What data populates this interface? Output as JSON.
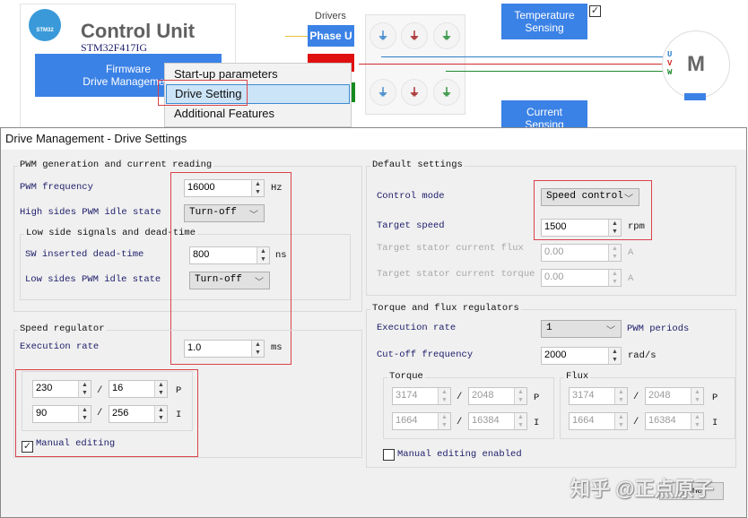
{
  "background": {
    "control_unit": {
      "title": "Control Unit",
      "mcu": "STM32F417IG",
      "logo_text": "STM32",
      "firmware_line1": "Firmware",
      "firmware_line2": "Drive Management"
    },
    "drivers_label": "Drivers",
    "phase_u": "Phase U",
    "temperature_sensing": "Temperature Sensing",
    "current_sensing": "Current Sensing",
    "motor": {
      "label": "M",
      "u": "U",
      "v": "V",
      "w": "W"
    },
    "context_menu": {
      "items": [
        {
          "label": "Start-up parameters",
          "selected": false
        },
        {
          "label": "Drive Setting",
          "selected": true
        },
        {
          "label": "Additional Features",
          "selected": false
        }
      ]
    }
  },
  "dialog": {
    "title": "Drive Management - Drive Settings",
    "pwm_group": {
      "title": "PWM generation and current reading",
      "pwm_frequency": {
        "label": "PWM frequency",
        "value": "16000",
        "unit": "Hz"
      },
      "high_idle": {
        "label": "High sides PWM idle state",
        "value": "Turn-off"
      },
      "low_side_group": {
        "title": "Low side signals and dead-time",
        "dead_time": {
          "label": "SW inserted dead-time",
          "value": "800",
          "unit": "ns"
        },
        "low_idle": {
          "label": "Low sides PWM idle state",
          "value": "Turn-off"
        }
      }
    },
    "speed_group": {
      "title": "Speed regulator",
      "exec_rate": {
        "label": "Execution rate",
        "value": "1.0",
        "unit": "ms"
      },
      "kp_num": "230",
      "kp_den": "16",
      "p": "P",
      "ki_num": "90",
      "ki_den": "256",
      "i": "I",
      "slash": "/",
      "manual_editing": {
        "label": "Manual editing",
        "checked": true
      }
    },
    "default_group": {
      "title": "Default settings",
      "control_mode": {
        "label": "Control mode",
        "value": "Speed control"
      },
      "target_speed": {
        "label": "Target speed",
        "value": "1500",
        "unit": "rpm"
      },
      "target_flux": {
        "label": "Target stator current flux",
        "value": "0.00",
        "unit": "A"
      },
      "target_torque": {
        "label": "Target stator current torque",
        "value": "0.00",
        "unit": "A"
      }
    },
    "tf_group": {
      "title": "Torque and flux regulators",
      "exec_rate": {
        "label": "Execution rate",
        "value": "1",
        "unit": "PWM periods"
      },
      "cutoff": {
        "label": "Cut-off frequency",
        "value": "2000",
        "unit": "rad/s"
      },
      "torque": {
        "title": "Torque",
        "kp_num": "3174",
        "kp_den": "2048",
        "ki_num": "1664",
        "ki_den": "16384"
      },
      "flux": {
        "title": "Flux",
        "kp_num": "3174",
        "kp_den": "2048",
        "ki_num": "1664",
        "ki_den": "16384"
      },
      "manual_editing": {
        "label": "Manual editing enabled",
        "checked": false
      }
    },
    "done_button": "Done"
  },
  "watermark": "知乎 @正点原子",
  "colors": {
    "accent_blue": "#3b82e6",
    "highlight_red": "#d9434a",
    "phase_u": "#2f7fc8",
    "phase_v": "#d22a2a",
    "phase_w": "#1e8a2e"
  }
}
